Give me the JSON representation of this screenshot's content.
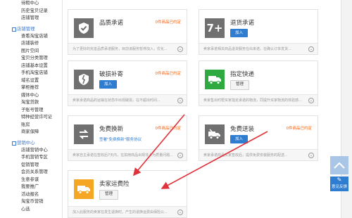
{
  "sidebar": {
    "top_items": [
      "待租中心",
      "历史宝贝记录",
      "店铺管理"
    ],
    "sections": [
      {
        "title": "店铺管理",
        "items": [
          "查看淘宝店铺",
          "店铺装修",
          "图片空间",
          "宝贝分类管理",
          "店铺基本设置",
          "手机淘宝店铺",
          "域名设置",
          "掌柜推荐",
          "媒体中心",
          "淘宝贷款",
          "子账号管理",
          "特种经营许可证",
          "账房",
          "商家保障"
        ]
      },
      {
        "title": "营销中心",
        "items": [
          "店铺营销中心",
          "手机营销专区",
          "促销管理",
          "会员关系管理",
          "生意参谋",
          "我要推广",
          "活动报名",
          "淘宝币营销",
          "心选"
        ]
      }
    ]
  },
  "cards": [
    {
      "title": "品质承诺",
      "note": "0件商品已约定",
      "desc": "为了更好的完善品质承诺服务，目前该服务暂停加入，优化..."
    },
    {
      "title": "退货承诺",
      "button": "加入",
      "desc": "卖家承诺相关商品退货服务在出来诺，在确认订单发货..."
    },
    {
      "title": "破损补寄",
      "note": "0件商品已约定",
      "button": "加入",
      "desc": "卖家承诺商品的运输在状态中出现破损，在不超出时间..."
    },
    {
      "title": "指定快递",
      "button": "管理",
      "desc": "卖家售出时帮买家指定承诺的物流，同提升买家物流的体验感..."
    },
    {
      "title": "免费换新",
      "note": "0件商品已约定",
      "link": "签署\"免费换新\"服务协议",
      "desc": "卖家自主承诺在签收后7天内，在如用商品出现非人为质量问题..."
    },
    {
      "title": "免费送装",
      "note": "0件商品已约定",
      "button": "加入",
      "desc": "卖家承诺商品买家签收后，提供免费安装服务的配送..."
    },
    {
      "title": "卖家运费险",
      "button": "管理",
      "desc": "加入此服务的卖家在发生退换时，产生的退换运费由保险公..."
    }
  ],
  "icons": {
    "card_icons": [
      "badge-check-icon",
      "seven-plus-icon",
      "broken-shield-icon",
      "delivery-truck-icon",
      "exchange-icon",
      "forklift-truck-icon",
      "insurance-truck-icon"
    ]
  },
  "floating": {
    "feedback_label": "意见反馈"
  },
  "colors": {
    "accent_blue": "#2f7dd1",
    "note_orange": "#ff5a00",
    "arrow_red": "#e0323a"
  }
}
